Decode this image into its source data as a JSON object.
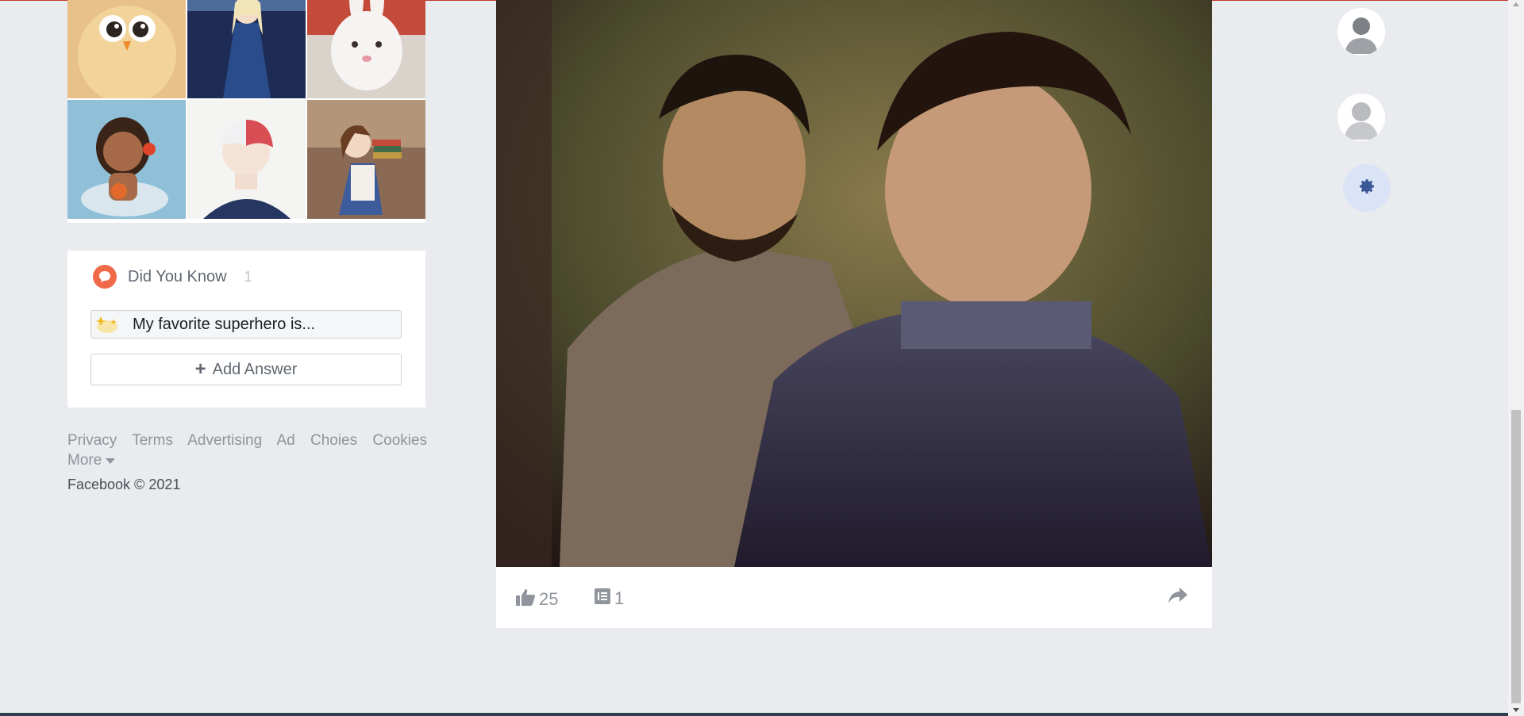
{
  "photo_grid": {
    "tiles": [
      {
        "name": "photo-tile-yellow-bird"
      },
      {
        "name": "photo-tile-princess-blue-dress"
      },
      {
        "name": "photo-tile-white-bunny"
      },
      {
        "name": "photo-tile-island-girl"
      },
      {
        "name": "photo-tile-anime-boy"
      },
      {
        "name": "photo-tile-girl-with-books"
      }
    ]
  },
  "did_you_know": {
    "title": "Did You Know",
    "count": "1",
    "question": "My favorite superhero is...",
    "add_answer_label": "Add Answer"
  },
  "footer": {
    "links": [
      "Privacy",
      "Terms",
      "Advertising",
      "Ad",
      "Choies",
      "Cookies"
    ],
    "more_label": "More",
    "copyright": "Facebook © 2021"
  },
  "post": {
    "likes": "25",
    "comments": "1"
  },
  "colors": {
    "background": "#e9ebee",
    "accent": "#3b5998",
    "dyk_icon": "#f06a4a"
  },
  "icons": [
    "speech-bubble-icon",
    "sparkle-icon",
    "plus-icon",
    "thumbs-up-icon",
    "comment-icon",
    "share-icon",
    "gear-icon",
    "caret-down-icon"
  ]
}
